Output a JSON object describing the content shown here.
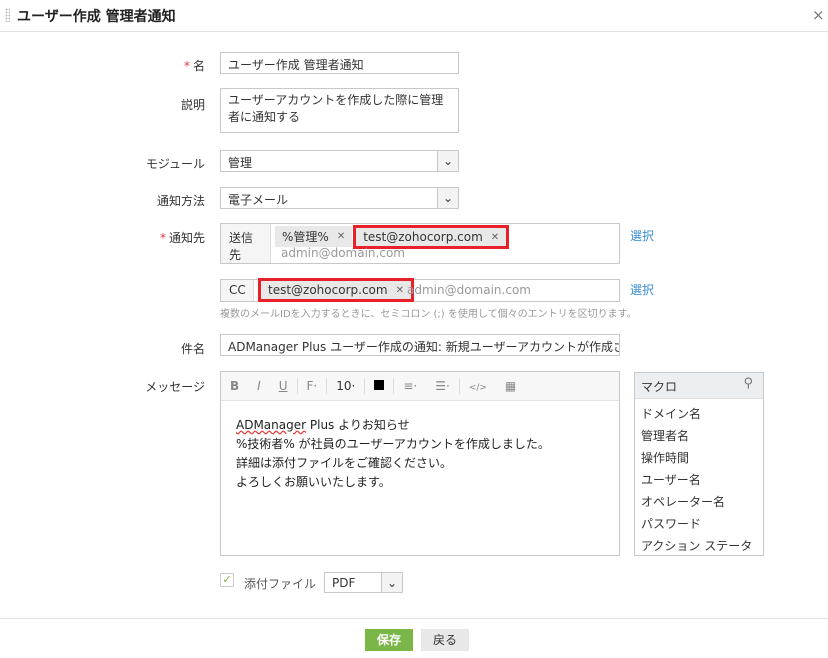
{
  "dialog": {
    "title": "ユーザー作成 管理者通知"
  },
  "form": {
    "name": {
      "label": "名",
      "value": "ユーザー作成 管理者通知"
    },
    "description": {
      "label": "説明",
      "value": "ユーザーアカウントを作成した際に管理者に通知する"
    },
    "module": {
      "label": "モジュール",
      "value": "管理"
    },
    "method": {
      "label": "通知方法",
      "value": "電子メール"
    },
    "recipients": {
      "label": "通知先",
      "to_label": "送信先",
      "to_chips": [
        "%管理%",
        "test@zohocorp.com"
      ],
      "to_placeholder": "admin@domain.com",
      "cc_label": "CC",
      "cc_chips": [
        "test@zohocorp.com"
      ],
      "cc_placeholder": "admin@domain.com",
      "select_label": "選択",
      "hint": "複数のメールIDを入力するときに、セミコロン (;) を使用して個々のエントリを区切ります。"
    },
    "subject": {
      "label": "件名",
      "value": "ADManager Plus ユーザー作成の通知: 新規ユーザーアカウントが作成されました"
    },
    "message": {
      "label": "メッセージ",
      "font_size": "10",
      "lines": [
        "ADManager Plus よりお知らせ",
        "%技術者% が社員のユーザーアカウントを作成しました。",
        "詳細は添付ファイルをご確認ください。",
        "よろしくお願いいたします。"
      ]
    },
    "macro": {
      "title": "マクロ",
      "items": [
        "ドメイン名",
        "管理者名",
        "操作時間",
        "ユーザー名",
        "オペレーター名",
        "パスワード",
        "アクション ステータス"
      ]
    },
    "attachment": {
      "label": "添付ファイル",
      "checked": true,
      "format": "PDF"
    }
  },
  "footer": {
    "save": "保存",
    "back": "戻る"
  },
  "colors": {
    "accent": "#7ab648",
    "highlight": "#e8202a",
    "link": "#3b8fcf"
  }
}
